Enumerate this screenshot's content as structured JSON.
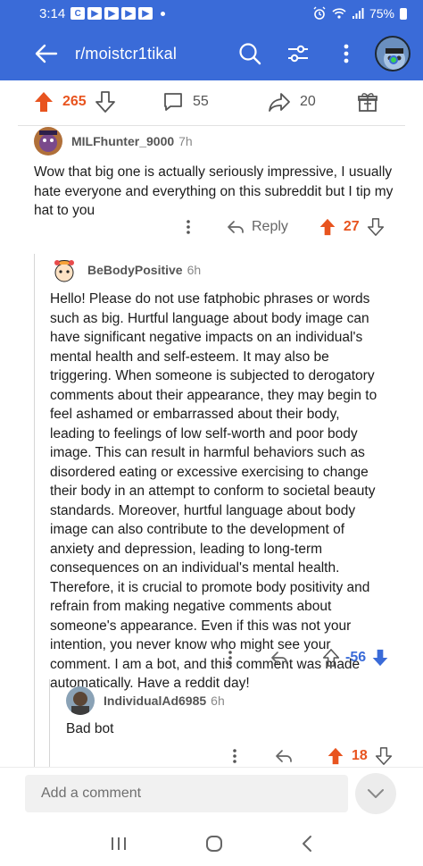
{
  "status_bar": {
    "time": "3:14",
    "notification_icons": [
      "C",
      "▶",
      "▶",
      "▶",
      "▶"
    ],
    "battery": "75%"
  },
  "header": {
    "title": "r/moistcr1tikal",
    "online_color": "#39d353",
    "brand_color": "#3a6bd8"
  },
  "post_actions": {
    "upvotes": "265",
    "comments": "55",
    "shares": "20"
  },
  "comments": [
    {
      "username": "MILFhunter_9000",
      "time": "7h",
      "body": "Wow that big one is actually seriously impressive, I usually hate everyone and everything on this subreddit but I tip my hat to you",
      "reply_label": "Reply",
      "score": "27",
      "vote_state": "upvoted"
    },
    {
      "username": "BeBodyPositive",
      "time": "6h",
      "body": "Hello! Please do not use fatphobic phrases or words such as big. Hurtful language about body image can have significant negative impacts on an individual's mental health and self-esteem. It may also be triggering. When someone is subjected to derogatory comments about their appearance, they may begin to feel ashamed or embarrassed about their body, leading to feelings of low self-worth and poor body image. This can result in harmful behaviors such as disordered eating or excessive exercising to change their body in an attempt to conform to societal beauty standards. Moreover, hurtful language about body image can also contribute to the development of anxiety and depression, leading to long-term consequences on an individual's mental health. Therefore, it is crucial to promote body positivity and refrain from making negative comments about someone's appearance. Even if this was not your intention, you never know who might see your comment. I am a bot, and this comment was made automatically. Have a reddit day!",
      "score": "-56",
      "vote_state": "downvoted"
    },
    {
      "username": "IndividualAd6985",
      "time": "6h",
      "body": "Bad bot",
      "score": "18",
      "vote_state": "upvoted"
    }
  ],
  "comment_bar": {
    "placeholder": "Add a comment"
  },
  "colors": {
    "upvote": "#e8541f",
    "downvote": "#3a6bd8"
  }
}
